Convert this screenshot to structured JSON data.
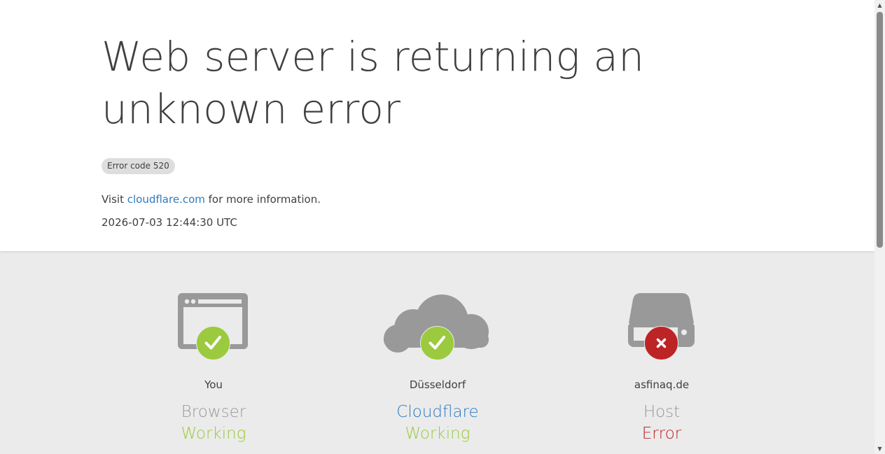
{
  "header": {
    "title": "Web server is returning an unknown error",
    "error_code": "Error code 520",
    "visit_prefix": "Visit ",
    "visit_link": "cloudflare.com",
    "visit_suffix": " for more information.",
    "timestamp": "2026-07-03 12:44:30 UTC"
  },
  "status": [
    {
      "location": "You",
      "name": "Browser",
      "status": "Working",
      "icon": "browser-icon",
      "badge": "check-icon"
    },
    {
      "location": "Düsseldorf",
      "name": "Cloudflare",
      "status": "Working",
      "icon": "cloud-icon",
      "badge": "check-icon"
    },
    {
      "location": "asfinaq.de",
      "name": "Host",
      "status": "Error",
      "icon": "server-icon",
      "badge": "error-x-icon"
    }
  ],
  "colors": {
    "ok": "#9bca3e",
    "error": "#bd2426",
    "link": "#2f7bbf",
    "text": "#404040",
    "muted": "#999999",
    "icon_gray": "#999999",
    "panel_bg": "#ebebeb"
  }
}
